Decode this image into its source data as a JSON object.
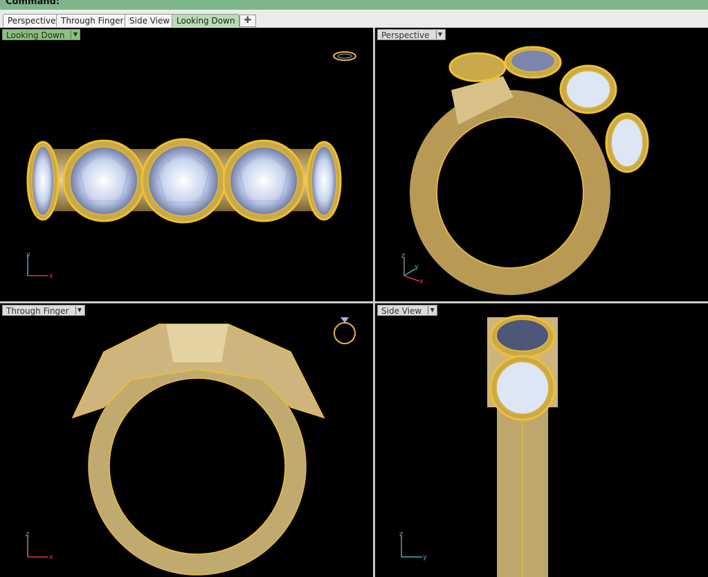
{
  "command_bar": {
    "label": "Command:"
  },
  "tabs": [
    {
      "label": "Perspective",
      "active": false
    },
    {
      "label": "Through Finger",
      "active": false
    },
    {
      "label": "Side View",
      "active": false
    },
    {
      "label": "Looking Down",
      "active": true
    }
  ],
  "add_tab_icon": "plus-icon",
  "viewports": {
    "top_left": {
      "title": "Looking Down",
      "active": true,
      "axes": [
        "y",
        "x"
      ]
    },
    "top_right": {
      "title": "Perspective",
      "active": false,
      "axes": [
        "z",
        "y",
        "x"
      ]
    },
    "bottom_left": {
      "title": "Through Finger",
      "active": false,
      "axes": [
        "z",
        "x"
      ]
    },
    "bottom_right": {
      "title": "Side View",
      "active": false,
      "axes": [
        "z",
        "y"
      ]
    }
  },
  "colors": {
    "command_bar": "#7fb58a",
    "active_tab": "#b8dcb3",
    "viewport_bg": "#000000",
    "gold": "#c9b27a",
    "gold_edge": "#f0c030",
    "diamond": "#dce6f5",
    "axis_x": "#d04040",
    "axis_y": "#40b0c0",
    "axis_z": "#888888"
  }
}
